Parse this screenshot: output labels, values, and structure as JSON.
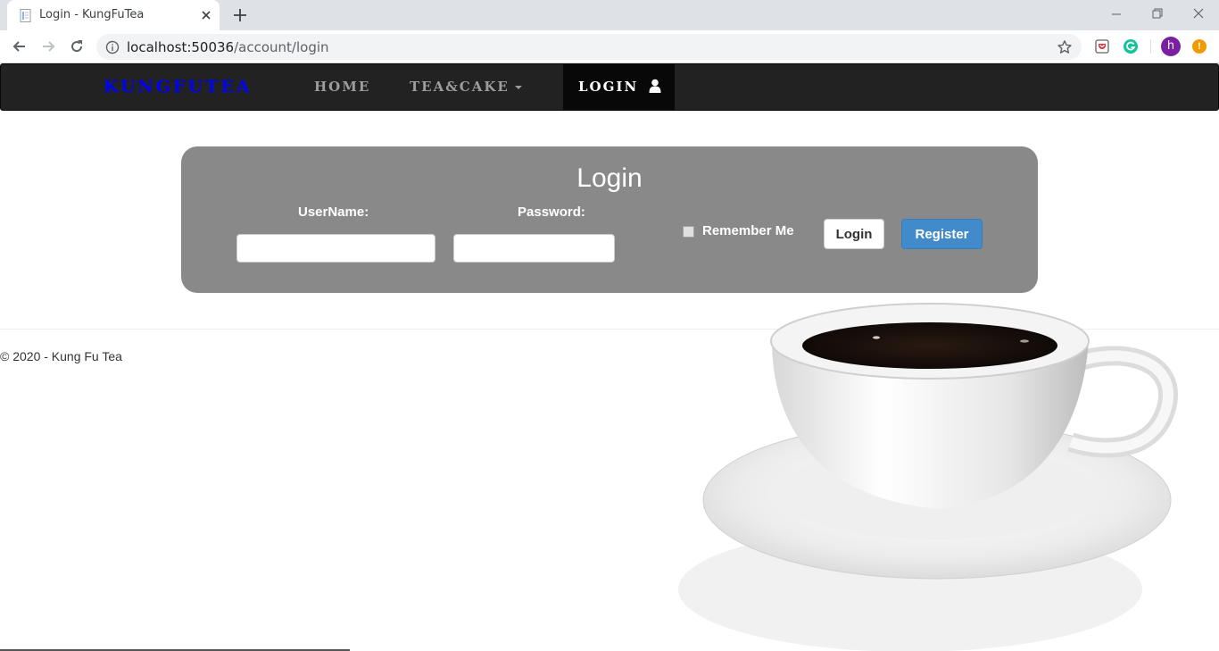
{
  "browser": {
    "tab_title": "Login - KungFuTea",
    "url_host": "localhost:50036",
    "url_path": "/account/login",
    "profile_initial": "h",
    "update_badge": "!"
  },
  "navbar": {
    "brand": "KungFuTea",
    "links": [
      {
        "label": "Home"
      },
      {
        "label": "Tea&Cake"
      }
    ],
    "active": {
      "label": "Login"
    }
  },
  "login": {
    "title": "Login",
    "username_label": "UserName:",
    "username_value": "",
    "password_label": "Password:",
    "password_value": "",
    "remember_label": "Remember Me",
    "remember_checked": false,
    "login_button": "Login",
    "register_button": "Register"
  },
  "footer": {
    "text": "© 2020 - Kung Fu Tea"
  },
  "colors": {
    "brand": "#0000ff",
    "navbar_bg": "#222222",
    "panel_bg": "#898989",
    "register_bg": "#428bca"
  }
}
